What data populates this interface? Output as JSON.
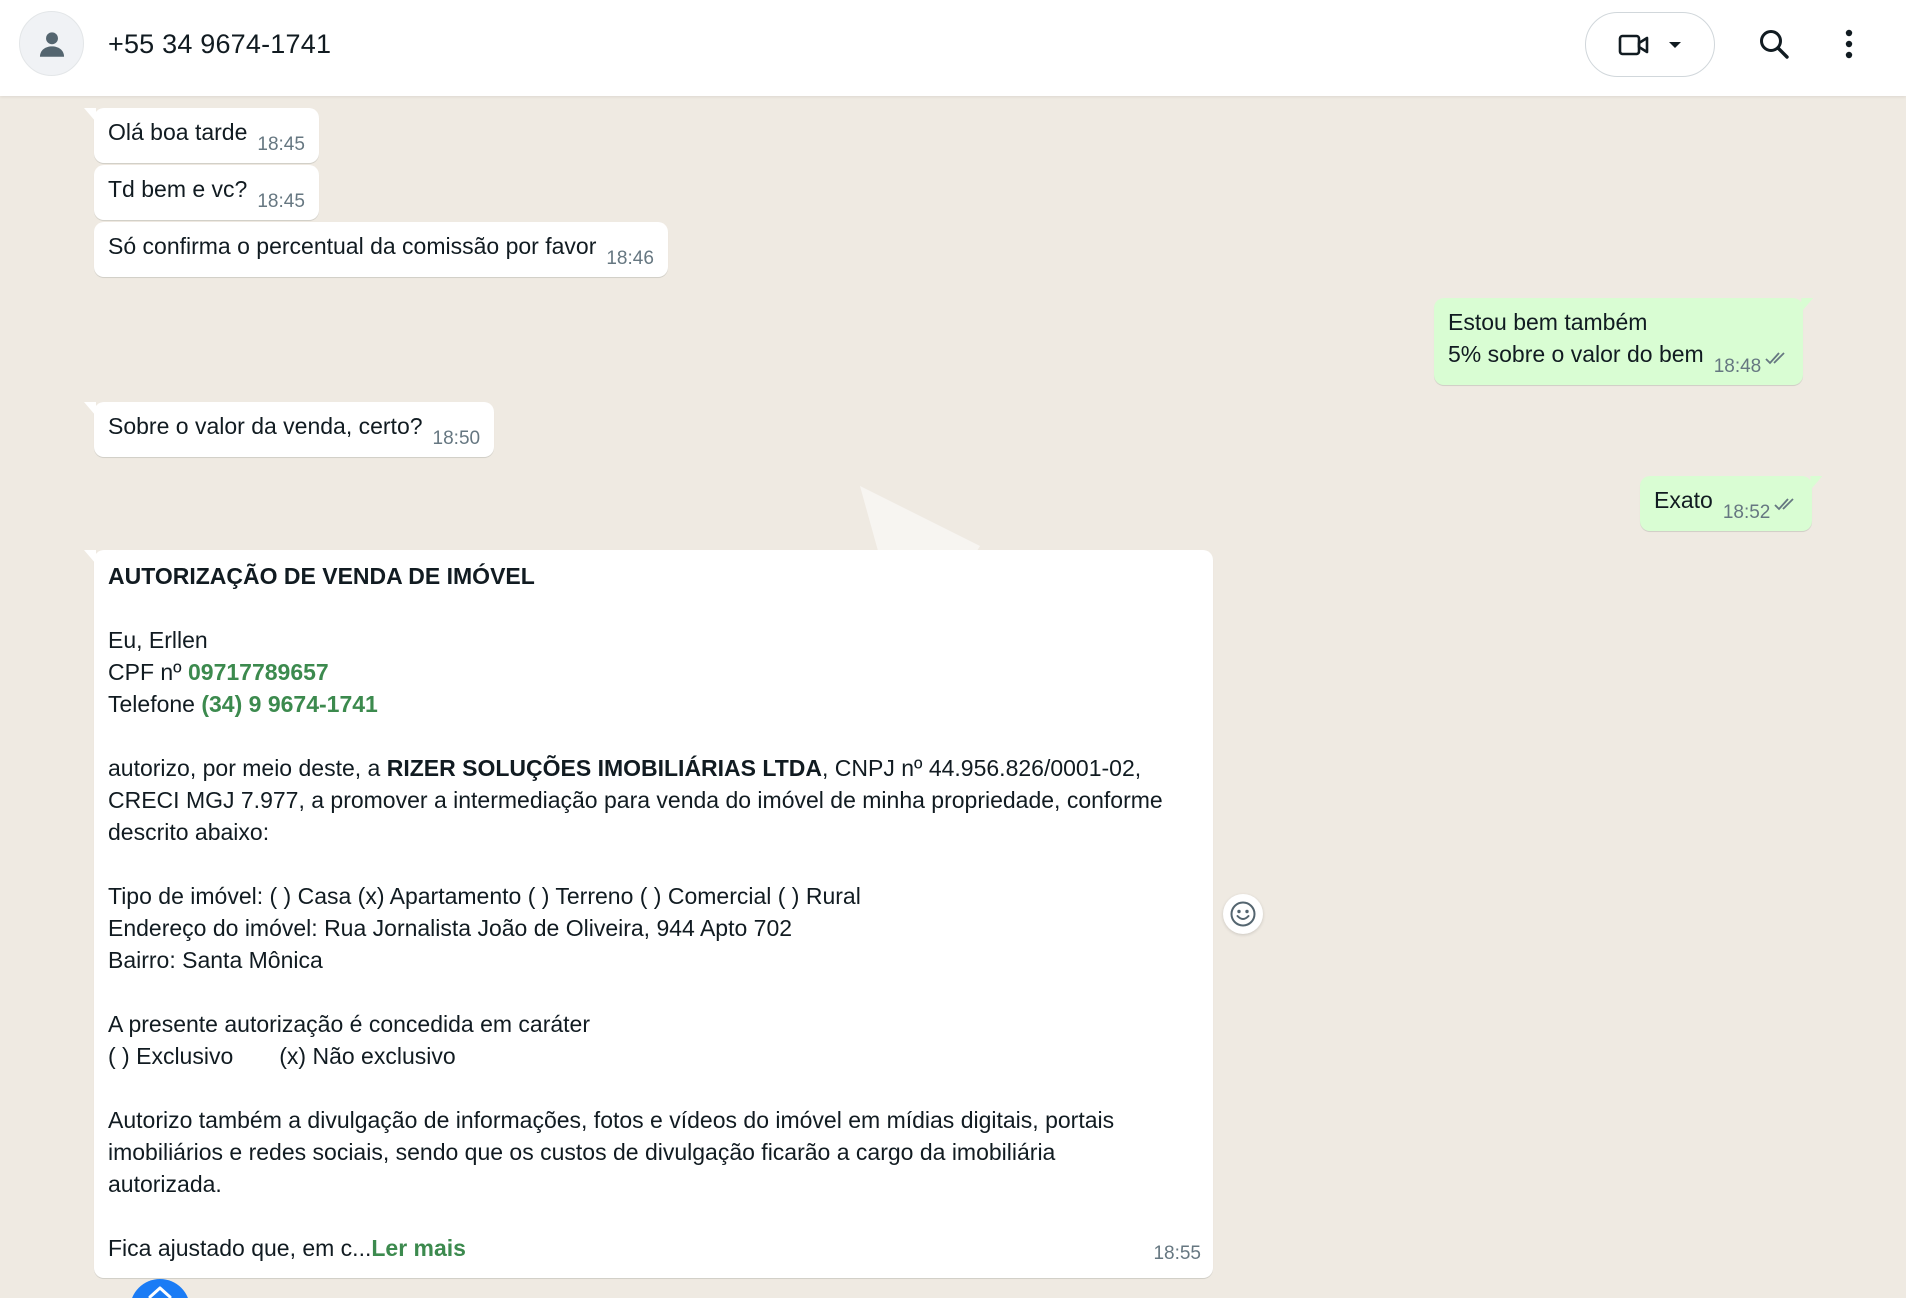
{
  "header": {
    "contact_name": "+55 34 9674-1741",
    "icons": [
      "avatar-icon",
      "video-call-icon",
      "chevron-down-icon",
      "search-icon",
      "more-options-icon"
    ]
  },
  "messages": [
    {
      "direction": "in",
      "text": "Olá boa tarde",
      "time": "18:45"
    },
    {
      "direction": "in",
      "text": "Td bem e vc?",
      "time": "18:45"
    },
    {
      "direction": "in",
      "text": "Só confirma o percentual da comissão por favor",
      "time": "18:46"
    },
    {
      "direction": "out",
      "lines": [
        "Estou bem também",
        "5% sobre o valor do bem"
      ],
      "time": "18:48",
      "status": "read"
    },
    {
      "direction": "in",
      "text": "Sobre o valor da venda, certo?",
      "time": "18:50"
    },
    {
      "direction": "out",
      "text": "Exato",
      "time": "18:52",
      "status": "read"
    }
  ],
  "document_message": {
    "title": "AUTORIZAÇÃO DE VENDA DE IMÓVEL",
    "name_line": "Eu, Erllen",
    "cpf_label": "CPF nº ",
    "cpf_value": "09717789657",
    "phone_label": "Telefone ",
    "phone_value": "(34) 9 9674-1741",
    "para1_start": "autorizo, por meio deste, a ",
    "company": "RIZER SOLUÇÕES IMOBILIÁRIAS LTDA",
    "para1_rest": ", CNPJ nº 44.956.826/0001-02,",
    "para1_line2": "CRECI MGJ 7.977, a promover a intermediação para venda do imóvel de minha propriedade, conforme",
    "para1_line3": "descrito abaixo:",
    "property_type": "Tipo de imóvel: ( ) Casa (x) Apartamento ( ) Terreno ( ) Comercial ( ) Rural",
    "address": "Endereço do imóvel: Rua Jornalista João de Oliveira, 944 Apto 702",
    "neighborhood": "Bairro: Santa Mônica",
    "character_line": "A presente autorização é concedida em caráter",
    "exclusive_option": "( ) Exclusivo",
    "non_exclusive_option": "(x) Não exclusivo",
    "para2_line1": "Autorizo também a divulgação de informações, fotos e vídeos do imóvel em mídias digitais, portais",
    "para2_line2": "imobiliários e redes sociais, sendo que os custos de divulgação ficarão a cargo da imobiliária",
    "para2_line3": "autorizada.",
    "truncated_text": "Fica ajustado que, em c...",
    "read_more": "Ler mais",
    "time": "18:55"
  },
  "colors": {
    "header_bg": "#ffffff",
    "chat_bg": "#efeae2",
    "incoming_bubble": "#ffffff",
    "outgoing_bubble": "#d9fdd3",
    "link_green": "#3c8a4e",
    "read_ticks": "#667781",
    "scroll_button": "#1b7cf5"
  }
}
